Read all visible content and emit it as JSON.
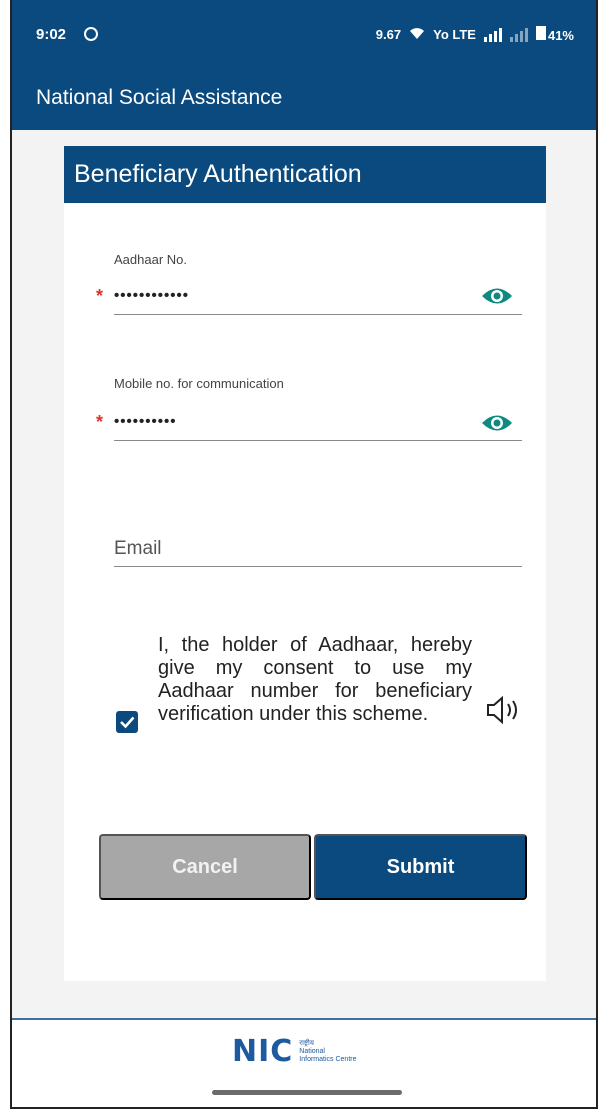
{
  "status_bar": {
    "time": "9:02",
    "speed": "9.67",
    "network": "Yo LTE",
    "battery": "41%"
  },
  "app_bar": {
    "title": "National Social Assistance"
  },
  "form": {
    "header": "Beneficiary Authentication",
    "aadhaar": {
      "label": "Aadhaar No.",
      "required_mark": "*",
      "value": "••••••••••••"
    },
    "mobile": {
      "label": "Mobile no. for communication",
      "required_mark": "*",
      "value": "••••••••••"
    },
    "email": {
      "placeholder": "Email"
    },
    "consent": {
      "checked": true,
      "text": "I, the holder of Aadhaar, hereby give my consent to use my Aadhaar number for beneficiary verification under this scheme."
    },
    "cancel_label": "Cancel",
    "submit_label": "Submit"
  },
  "footer": {
    "logo_text": "NIC",
    "logo_hindi": "राष्ट्रीय",
    "logo_subtitle": "National Informatics Centre"
  },
  "colors": {
    "primary": "#0b4a7e",
    "cancel": "#a7a7a7",
    "required": "#d9342b",
    "eye_icon": "#0e8a80"
  }
}
